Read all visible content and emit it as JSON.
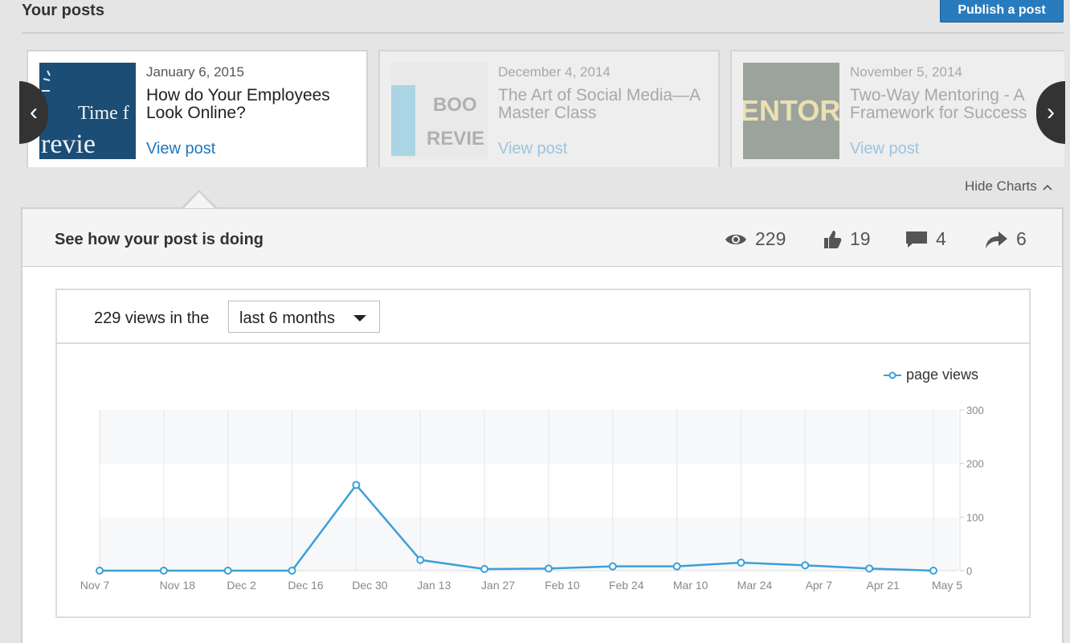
{
  "header": {
    "title": "Your posts",
    "publish_label": "Publish a post"
  },
  "posts": [
    {
      "date": "January 6, 2015",
      "title": "How do Your Employees Look Online?",
      "link": "View post",
      "thumb_text": [
        "Time f",
        "revie"
      ]
    },
    {
      "date": "December 4, 2014",
      "title": "The Art of Social Media—A Master Class",
      "link": "View post",
      "thumb_text": [
        "BOO",
        "REVIE"
      ]
    },
    {
      "date": "November 5, 2014",
      "title": "Two-Way Mentoring - A Framework for Success",
      "link": "View post",
      "thumb_text": [
        "ENTORI"
      ]
    }
  ],
  "hide_charts_label": "Hide Charts",
  "panel": {
    "title": "See how your post is doing",
    "stats": {
      "views": "229",
      "likes": "19",
      "comments": "4",
      "shares": "6"
    }
  },
  "chart_header": {
    "views_text": "229 views in the",
    "range_selected": "last 6 months"
  },
  "colors": {
    "accent": "#287bbc",
    "series": "#3aa0d8",
    "link": "#1c78bf"
  },
  "chart_data": {
    "type": "line",
    "x": [
      "Nov 7",
      "Nov 18",
      "Dec 2",
      "Dec 16",
      "Dec 30",
      "Jan 13",
      "Jan 27",
      "Feb 10",
      "Feb 24",
      "Mar 10",
      "Mar 24",
      "Apr 7",
      "Apr 21",
      "May 5"
    ],
    "series": [
      {
        "name": "page views",
        "values": [
          0,
          0,
          0,
          0,
          160,
          20,
          3,
          4,
          8,
          8,
          15,
          10,
          4,
          0
        ]
      }
    ],
    "ylim": [
      0,
      300
    ],
    "yticks": [
      0,
      100,
      200,
      300
    ],
    "legend": "top-right",
    "grid": true
  }
}
